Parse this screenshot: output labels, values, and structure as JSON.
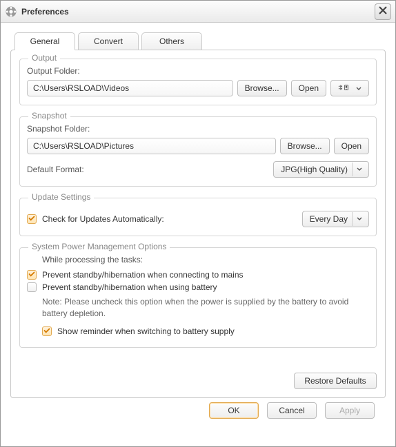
{
  "title": "Preferences",
  "tabs": {
    "general": "General",
    "convert": "Convert",
    "others": "Others"
  },
  "output": {
    "legend": "Output",
    "folder_label": "Output Folder:",
    "folder_value": "C:\\Users\\RSLOAD\\Videos",
    "browse": "Browse...",
    "open": "Open"
  },
  "snapshot": {
    "legend": "Snapshot",
    "folder_label": "Snapshot Folder:",
    "folder_value": "C:\\Users\\RSLOAD\\Pictures",
    "browse": "Browse...",
    "open": "Open",
    "default_format_label": "Default Format:",
    "default_format_value": "JPG(High Quality)"
  },
  "update": {
    "legend": "Update Settings",
    "check_label": "Check for Updates Automatically:",
    "frequency": "Every Day"
  },
  "power": {
    "legend": "System Power Management Options",
    "while_label": "While processing the tasks:",
    "prevent_mains": "Prevent standby/hibernation when connecting to mains",
    "prevent_battery": "Prevent standby/hibernation when using battery",
    "note": "Note: Please uncheck this option when the power is supplied by the battery to avoid battery depletion.",
    "show_reminder": "Show reminder when switching to battery supply"
  },
  "buttons": {
    "restore": "Restore Defaults",
    "ok": "OK",
    "cancel": "Cancel",
    "apply": "Apply"
  }
}
